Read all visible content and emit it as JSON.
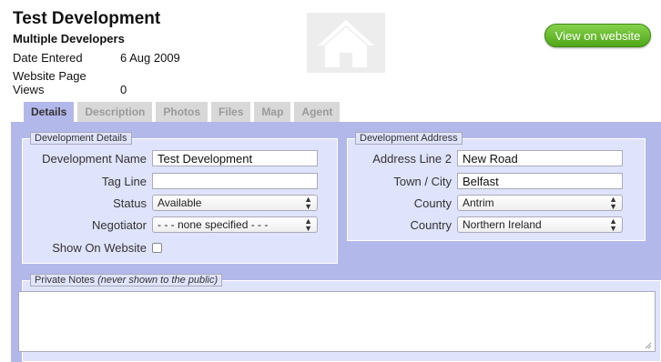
{
  "header": {
    "title": "Test Development",
    "subtitle": "Multiple Developers",
    "meta": [
      {
        "label": "Date Entered",
        "value": "6 Aug 2009"
      },
      {
        "label": "Website Page Views",
        "value": "0"
      }
    ],
    "view_button": "View on website"
  },
  "tabs": [
    "Details",
    "Description",
    "Photos",
    "Files",
    "Map",
    "Agent"
  ],
  "active_tab": "Details",
  "development_details": {
    "legend": "Development Details",
    "fields": {
      "name": {
        "label": "Development Name",
        "value": "Test Development"
      },
      "tagline": {
        "label": "Tag Line",
        "value": ""
      },
      "status": {
        "label": "Status",
        "value": "Available"
      },
      "negotiator": {
        "label": "Negotiator",
        "value": "- - - none specified - - -"
      },
      "show_on_website": {
        "label": "Show On Website",
        "checked": false
      }
    }
  },
  "development_address": {
    "legend": "Development Address",
    "fields": {
      "address2": {
        "label": "Address Line 2",
        "value": "New Road"
      },
      "town": {
        "label": "Town / City",
        "value": "Belfast"
      },
      "county": {
        "label": "County",
        "value": "Antrim"
      },
      "country": {
        "label": "Country",
        "value": "Northern Ireland"
      }
    }
  },
  "private_notes": {
    "legend": "Private Notes",
    "legend_note": "(never shown to the public)",
    "value": ""
  },
  "colors": {
    "accent_green": "#5cb523",
    "tab_active": "#b3b8ea",
    "panel_bg": "#dfe3fb"
  }
}
